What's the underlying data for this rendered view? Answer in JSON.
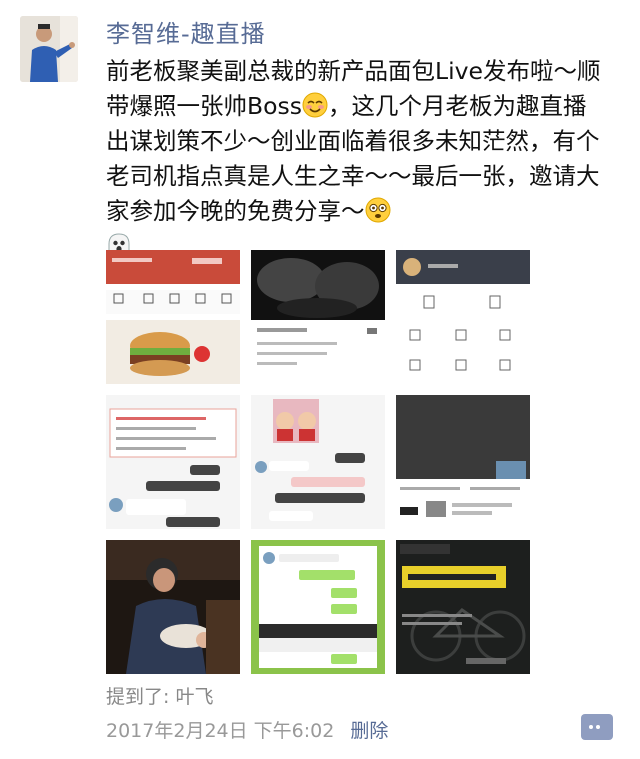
{
  "post": {
    "author": "李智维-趣直播",
    "text_before_emoji": "前老板聚美副总裁的新产品面包Live发布啦～顺带爆照一张帅Boss",
    "text_middle": "，这几个月老板为趣直播出谋划策不少～创业面临着很多未知茫然，有个老司机指点真是人生之幸～～最后一张，邀请大家参加今晚的免费分享～",
    "emoji_names": [
      "blush-emoji",
      "dizzy-emoji",
      "ghost-emoji"
    ],
    "mention": "提到了: 叶飞",
    "timestamp": "2017年2月24日 下午6:02",
    "delete_label": "删除"
  },
  "images": [
    {
      "name": "app-home-screenshot"
    },
    {
      "name": "muscle-photo"
    },
    {
      "name": "app-menu-screenshot"
    },
    {
      "name": "chat-screenshot-1"
    },
    {
      "name": "chat-screenshot-2"
    },
    {
      "name": "chat-screenshot-3"
    },
    {
      "name": "father-child-photo"
    },
    {
      "name": "chat-screenshot-4"
    },
    {
      "name": "bicycle-poster"
    }
  ],
  "colors": {
    "link": "#576b95",
    "meta": "#999999",
    "text": "#111111"
  }
}
